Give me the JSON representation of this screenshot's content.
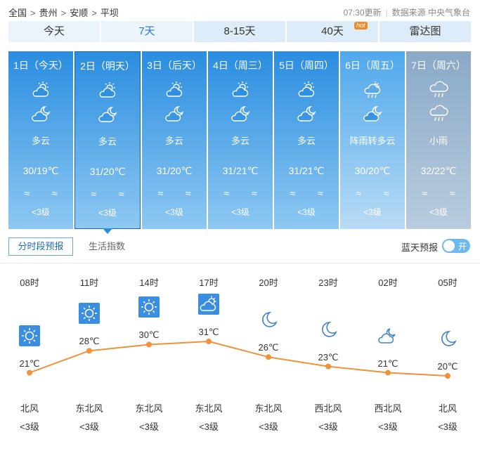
{
  "breadcrumb": {
    "country": "全国",
    "province": "贵州",
    "city": "安顺",
    "district": "平坝",
    "sep": ">"
  },
  "meta": {
    "updated": "07:30更新",
    "source": "数据来源 中央气象台"
  },
  "tabs": [
    {
      "label": "今天"
    },
    {
      "label": "7天"
    },
    {
      "label": "8-15天"
    },
    {
      "label": "40天",
      "badge": "hot"
    },
    {
      "label": "雷达图"
    }
  ],
  "days": [
    {
      "date": "1日（今天）",
      "icon_day": "partly-cloudy-icon",
      "icon_night": "cloudy-night-icon",
      "desc": "多云",
      "temp": "30/19℃",
      "wind": "≈ ≈",
      "level": "<3级"
    },
    {
      "date": "2日（明天）",
      "icon_day": "partly-cloudy-icon",
      "icon_night": "cloudy-night-icon",
      "desc": "多云",
      "temp": "31/20℃",
      "wind": "≈ ≈",
      "level": "<3级"
    },
    {
      "date": "3日（后天）",
      "icon_day": "partly-cloudy-icon",
      "icon_night": "cloudy-night-icon",
      "desc": "多云",
      "temp": "31/20℃",
      "wind": "≈ ≈",
      "level": "<3级"
    },
    {
      "date": "4日（周三）",
      "icon_day": "partly-cloudy-icon",
      "icon_night": "cloudy-night-icon",
      "desc": "多云",
      "temp": "31/21℃",
      "wind": "≈ ≈",
      "level": "<3级"
    },
    {
      "date": "5日（周四）",
      "icon_day": "partly-cloudy-icon",
      "icon_night": "cloudy-night-icon",
      "desc": "多云",
      "temp": "31/21℃",
      "wind": "≈ ≈",
      "level": "<3级"
    },
    {
      "date": "6日（周五）",
      "icon_day": "shower-icon",
      "icon_night": "cloudy-night-icon",
      "desc": "阵雨转多云",
      "temp": "30/20℃",
      "wind": "≈ ≈",
      "level": "<3级"
    },
    {
      "date": "7日（周六）",
      "icon_day": "rain-icon",
      "icon_night": "rain-icon",
      "desc": "小雨",
      "temp": "32/22℃",
      "wind": "≈ ≈",
      "level": "<3级"
    }
  ],
  "subtabs": {
    "hourly": "分时段预报",
    "life": "生活指数"
  },
  "bluesky": {
    "label": "蓝天预报",
    "toggle": "开"
  },
  "hourly": [
    {
      "time": "08时",
      "icon": "sun-icon",
      "temp": "21℃",
      "temp_value": 21,
      "wind": "北风",
      "level": "<3级"
    },
    {
      "time": "11时",
      "icon": "sun-icon",
      "temp": "28℃",
      "temp_value": 28,
      "wind": "东北风",
      "level": "<3级"
    },
    {
      "time": "14时",
      "icon": "sun-icon",
      "temp": "30℃",
      "temp_value": 30,
      "wind": "东北风",
      "level": "<3级"
    },
    {
      "time": "17时",
      "icon": "partly-cloudy-icon",
      "temp": "31℃",
      "temp_value": 31,
      "wind": "东北风",
      "level": "<3级"
    },
    {
      "time": "20时",
      "icon": "moon-icon",
      "temp": "26℃",
      "temp_value": 26,
      "wind": "东北风",
      "level": "<3级"
    },
    {
      "time": "23时",
      "icon": "moon-icon",
      "temp": "23℃",
      "temp_value": 23,
      "wind": "西北风",
      "level": "<3级"
    },
    {
      "time": "02时",
      "icon": "cloudy-night-icon",
      "temp": "21℃",
      "temp_value": 21,
      "wind": "西北风",
      "level": "<3级"
    },
    {
      "time": "05时",
      "icon": "moon-icon",
      "temp": "20℃",
      "temp_value": 20,
      "wind": "北风",
      "level": "<3级"
    }
  ],
  "colors": {
    "accent": "#2a8de0",
    "line": "#f0923a",
    "rain_day": "#4fa8ec",
    "overcast_day": "#8aa9c7"
  }
}
